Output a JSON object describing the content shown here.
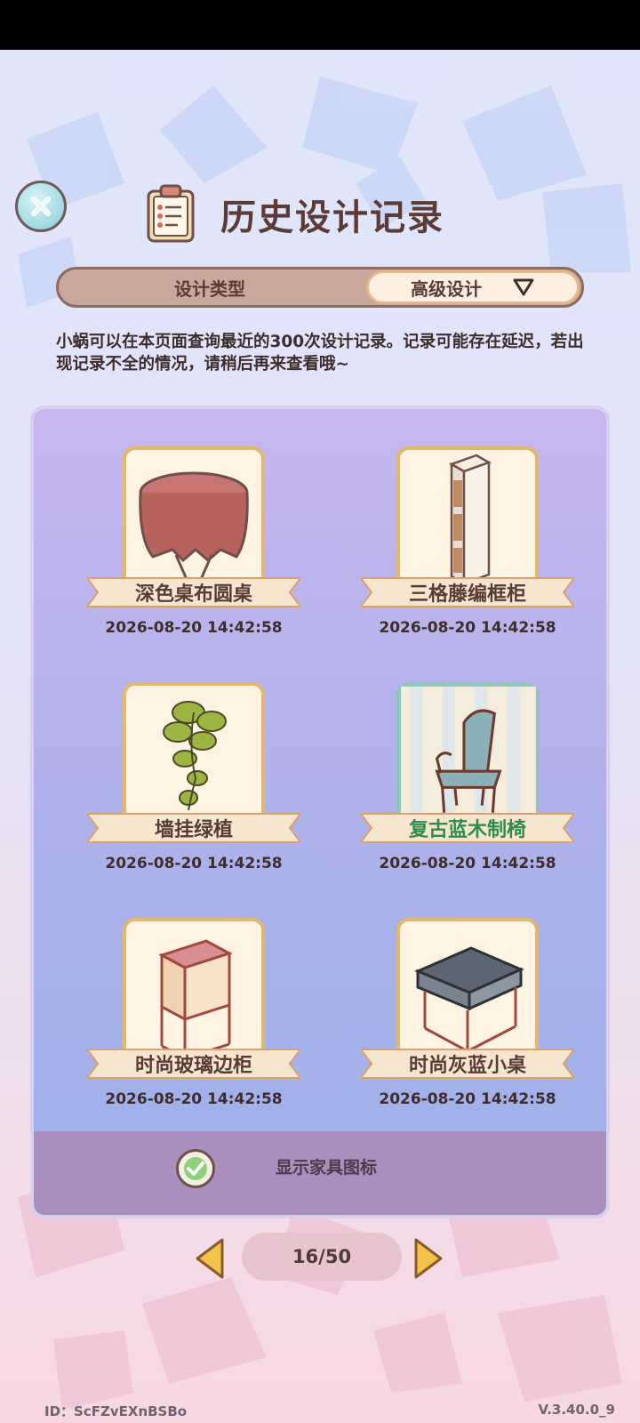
{
  "header": {
    "title": "历史设计记录",
    "close_icon": "close-icon",
    "title_icon": "clipboard-icon"
  },
  "tabs": {
    "design_type": "设计类型",
    "advanced": "高级设计",
    "advanced_icon": "triangle-down-icon"
  },
  "notice": "小蜗可以在本页面查询最近的300次设计记录。记录可能存在延迟，若出现记录不全的情况，请稍后再来查看哦~",
  "records": [
    {
      "name": "深色桌布圆桌",
      "time": "2026-08-20 14:42:58",
      "selected": false,
      "icon": "round-table-icon"
    },
    {
      "name": "三格藤编框柜",
      "time": "2026-08-20 14:42:58",
      "selected": false,
      "icon": "cabinet-icon"
    },
    {
      "name": "墙挂绿植",
      "time": "2026-08-20 14:42:58",
      "selected": false,
      "icon": "hanging-plant-icon"
    },
    {
      "name": "复古蓝木制椅",
      "time": "2026-08-20 14:42:58",
      "selected": true,
      "icon": "chair-icon"
    },
    {
      "name": "时尚玻璃边柜",
      "time": "2026-08-20 14:42:58",
      "selected": false,
      "icon": "glass-side-cabinet-icon"
    },
    {
      "name": "时尚灰蓝小桌",
      "time": "2026-08-20 14:42:58",
      "selected": false,
      "icon": "small-table-icon"
    }
  ],
  "footer": {
    "show_icons_label": "显示家具图标",
    "show_icons_checked": true
  },
  "pager": {
    "label": "16/50",
    "current": 16,
    "total": 50
  },
  "bottom": {
    "id": "ID：ScFZvEXnBSBo",
    "version": "V.3.40.0_9"
  },
  "colors": {
    "accent_brown": "#5a3b35",
    "frame_gold": "#e2b86c",
    "selected_teal": "#8fc7b8",
    "selected_text_green": "#2f8c4c"
  }
}
